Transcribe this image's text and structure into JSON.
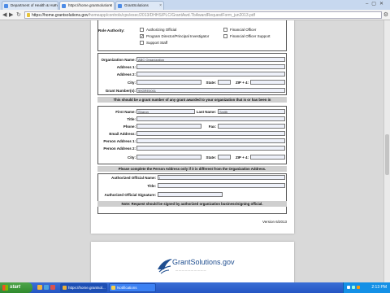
{
  "browser": {
    "tabs": [
      {
        "label": "Department of Health & Hum"
      },
      {
        "label": "https://home.grantsolutions"
      },
      {
        "label": "GrantSolutions"
      }
    ],
    "url_host": "https://home.grantsolutions.gov",
    "url_path": "/homeapp/controls/cps/exec/2013/DHHS/PLC/GrantAwd.TbAwardRequestForm_jun2013.pdf"
  },
  "form": {
    "role_authority_label": "Role Authority:",
    "roles": [
      {
        "label": "Authorizing Official",
        "checked": false
      },
      {
        "label": "Financial Officer",
        "checked": false
      },
      {
        "label": "Program Director/Principal Investigator",
        "checked": true
      },
      {
        "label": "Financial Officer Support",
        "checked": false
      },
      {
        "label": "Support Staff",
        "checked": false
      }
    ],
    "org_name_label": "Organization Name:",
    "org_name_value": "ABC Organization",
    "address1_label": "Address 1:",
    "address2_label": "Address 2:",
    "city_label": "City:",
    "state_label": "State:",
    "zip_label": "ZIP + 4:",
    "grant_numbers_label": "Grant Number(s):",
    "grant_numbers_value": "99GRE0001",
    "grant_note": "This should be a grant number of any grant awarded to your organization that is or has been in",
    "first_name_label": "First Name:",
    "first_name_value": "Sharon",
    "last_name_label": "Last Name:",
    "last_name_value": "Smith",
    "title_label": "Title:",
    "phone_label": "Phone:",
    "fax_label": "Fax:",
    "email_label": "Email Address:",
    "person_address1_label": "Person Address 1:",
    "person_address2_label": "Person Address 2:",
    "person_city_label": "City:",
    "person_state_label": "State:",
    "person_zip_label": "ZIP + 4:",
    "person_address_note": "Please complete the Person Address only if it is different from the Organization Address.",
    "ao_name_label": "Authorized Official Name:",
    "ao_title_label": "Title:",
    "ao_signature_label": "Authorized Official Signature:",
    "signature_note": "Note: Request should be signed by authorized organization business/signing official.",
    "version": "Version 6/2013"
  },
  "logo": {
    "text": "GrantSolutions.gov"
  },
  "taskbar": {
    "start_label": "start",
    "tasks": [
      {
        "label": "https://home.grantsol...",
        "active": true
      },
      {
        "label": "Notifications",
        "active": false
      }
    ],
    "clock": "2:13 PM"
  }
}
